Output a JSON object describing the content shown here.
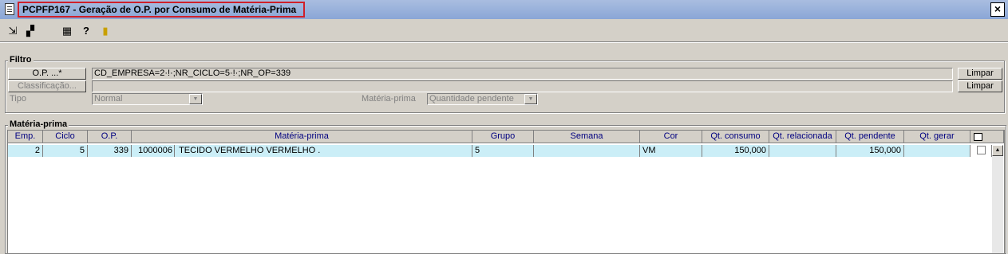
{
  "window": {
    "title": "PCPFP167 - Geração de O.P. por Consumo de Matéria-Prima",
    "close": "×"
  },
  "toolbar": [
    {
      "icon": "arrow-icon",
      "glyph": "⇲"
    },
    {
      "icon": "windows-icon",
      "glyph": "▞"
    },
    {
      "icon": "grid-icon",
      "glyph": "▦"
    },
    {
      "icon": "help-icon",
      "glyph": "?"
    },
    {
      "icon": "exit-door-icon",
      "glyph": "▮"
    }
  ],
  "filtro": {
    "legend": "Filtro",
    "op_button": "O.P. ...*",
    "op_value": "CD_EMPRESA=2·!·;NR_CICLO=5·!·;NR_OP=339",
    "op_clear": "Limpar",
    "class_button": "Classificação...",
    "class_value": "",
    "class_clear": "Limpar",
    "tipo_label": "Tipo",
    "tipo_value": "Normal",
    "materia_label": "Matéria-prima",
    "materia_value": "Quantidade pendente"
  },
  "materia": {
    "legend": "Matéria-prima",
    "columns": [
      "Emp.",
      "Ciclo",
      "O.P.",
      "Matéria-prima",
      "Grupo",
      "Semana",
      "Cor",
      "Qt. consumo",
      "Qt. relacionada",
      "Qt. pendente",
      "Qt. gerar"
    ],
    "rows": [
      {
        "emp": "2",
        "ciclo": "5",
        "op": "339",
        "codigo": "1000006",
        "materia": "TECIDO VERMELHO VERMELHO .",
        "grupo": "5",
        "semana": "",
        "cor": "VM",
        "consumo": "150,000",
        "relacionada": "",
        "pendente": "150,000",
        "gerar": ""
      }
    ]
  }
}
